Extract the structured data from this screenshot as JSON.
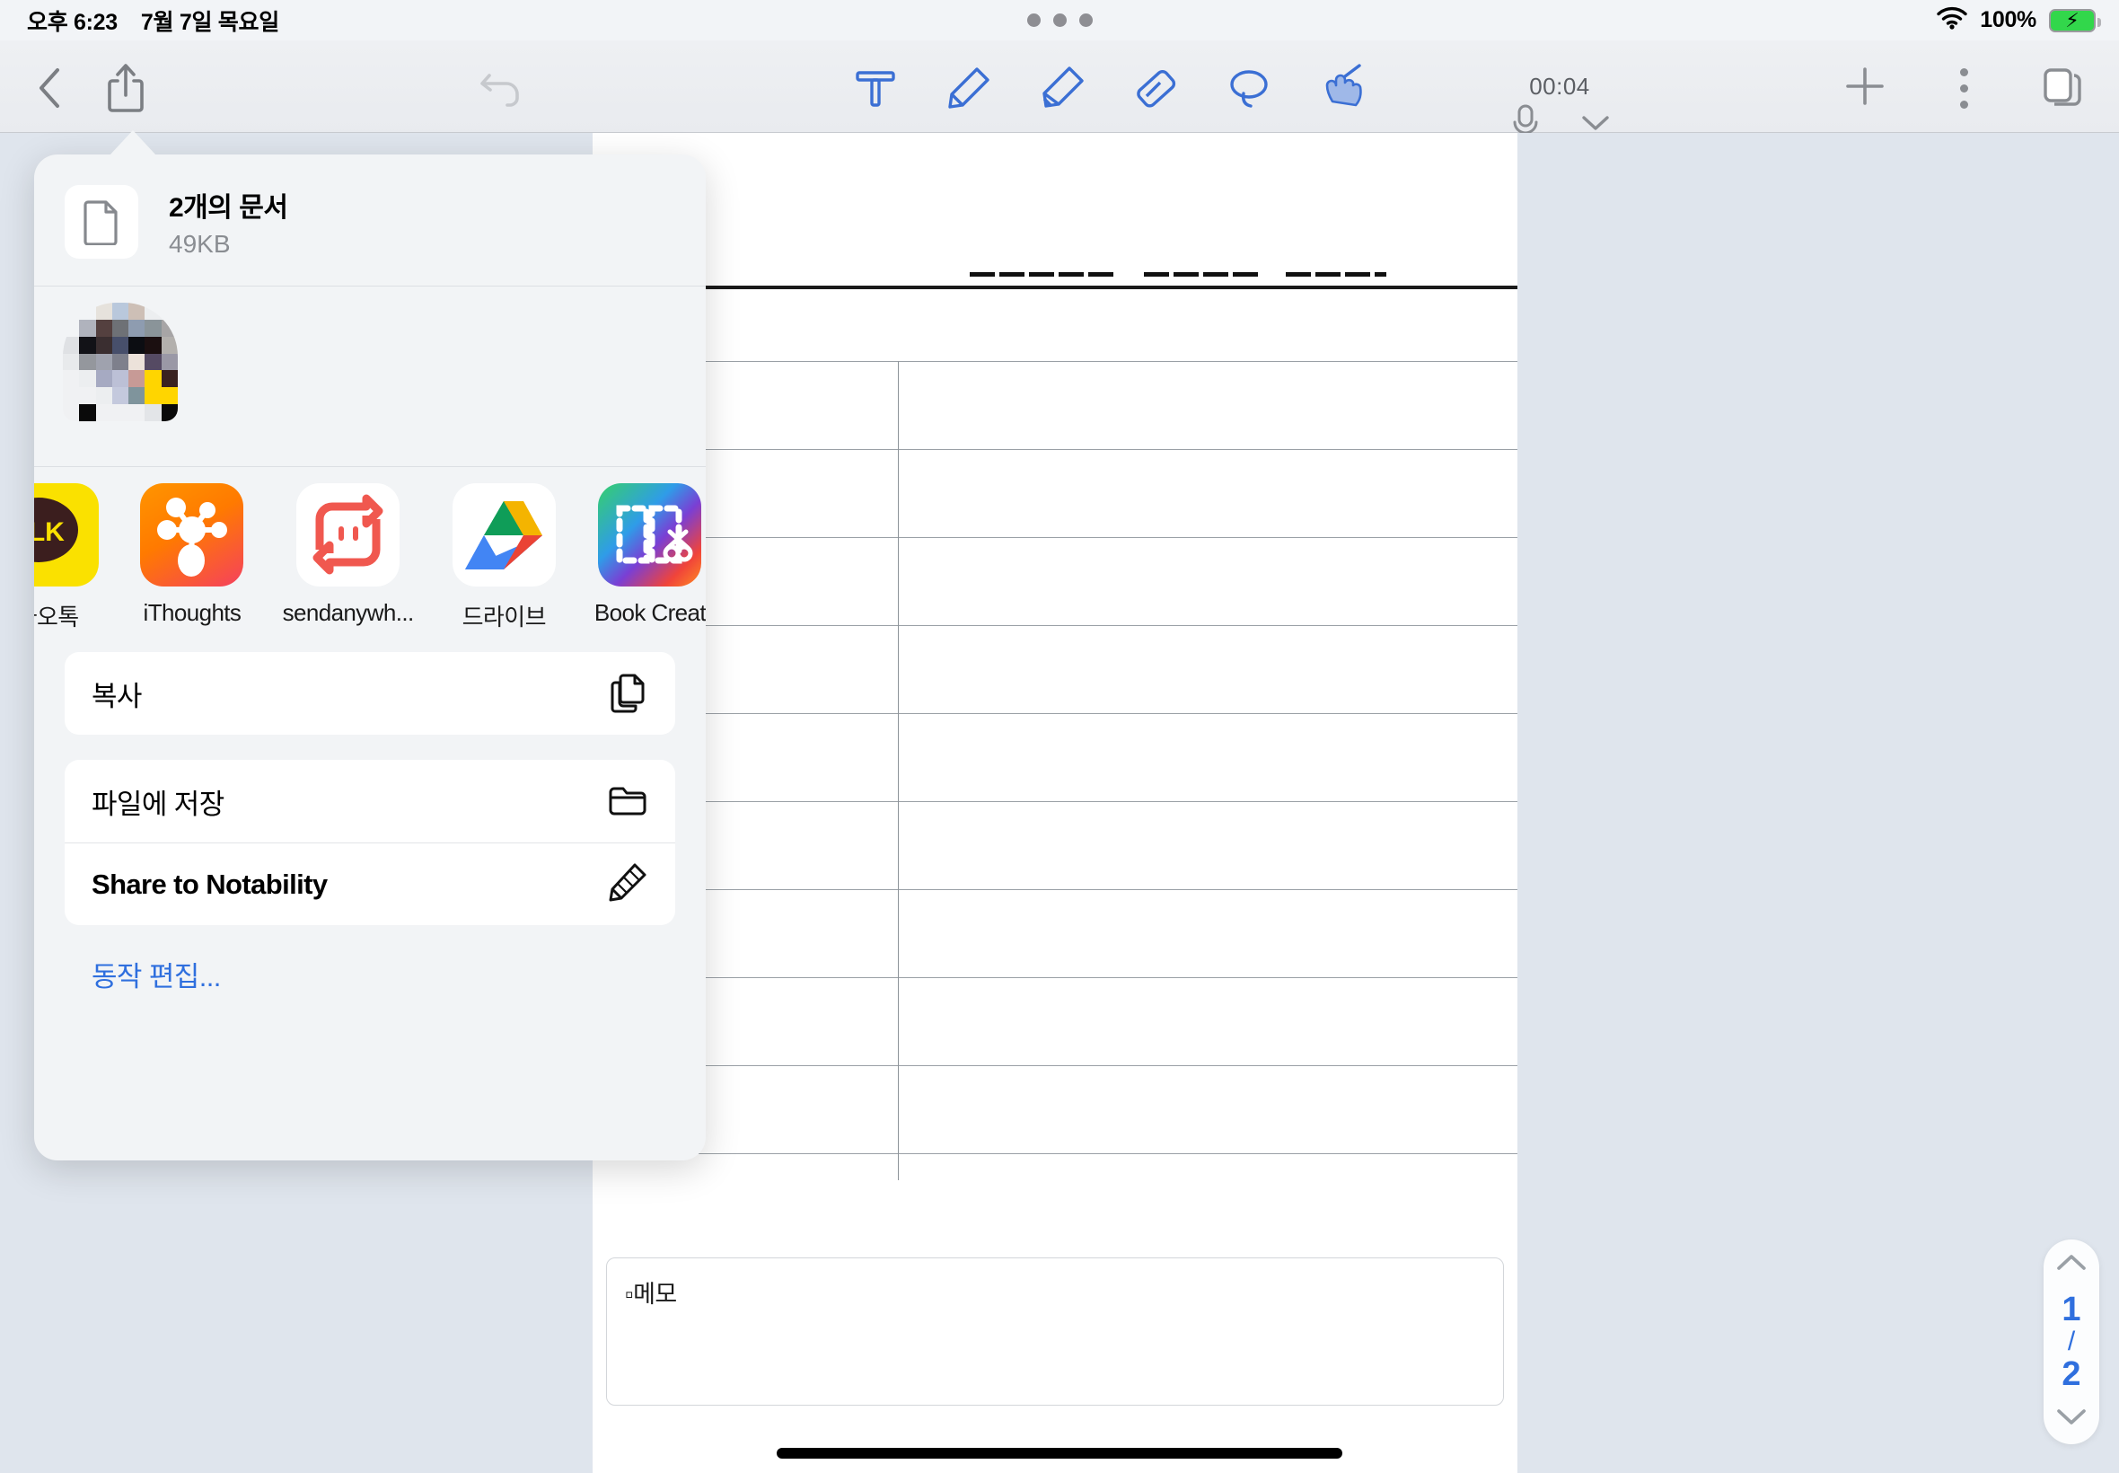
{
  "status_bar": {
    "time": "오후 6:23",
    "date": "7월 7일 목요일",
    "battery_percent": "100%",
    "wifi_icon": "wifi-icon",
    "battery_icon": "battery-charging-icon",
    "multitask_icon": "multitask-dots-icon"
  },
  "toolbar": {
    "back_icon": "chevron-left-icon",
    "share_icon": "share-up-arrow-icon",
    "undo_icon": "undo-arrow-icon",
    "tools": [
      {
        "name": "text-tool",
        "icon": "text-t-icon",
        "active": false
      },
      {
        "name": "pen-tool",
        "icon": "pen-icon",
        "active": false
      },
      {
        "name": "highlighter-tool",
        "icon": "highlighter-icon",
        "active": false
      },
      {
        "name": "eraser-tool",
        "icon": "eraser-icon",
        "active": false
      },
      {
        "name": "lasso-tool",
        "icon": "lasso-icon",
        "active": false
      },
      {
        "name": "hand-tool",
        "icon": "hand-pointer-icon",
        "active": true
      }
    ],
    "recording_time": "00:04",
    "mic_icon": "microphone-icon",
    "chevron_icon": "chevron-down-icon",
    "add_icon": "plus-icon",
    "more_icon": "kebab-menu-icon",
    "pages_icon": "pages-stack-icon"
  },
  "document": {
    "memo_label": "▫메모",
    "page_navigator": {
      "up_icon": "chevron-up-icon",
      "current_page": "1",
      "separator": "/",
      "total_pages": "2",
      "down_icon": "chevron-down-icon"
    }
  },
  "share_sheet": {
    "doc_icon": "document-icon",
    "title": "2개의 문서",
    "size": "49KB",
    "preview_name": "blurred-thumbnail-preview",
    "apps": [
      {
        "label": "카오톡",
        "icon": "kakaotalk-icon"
      },
      {
        "label": "iThoughts",
        "icon": "ithoughts-icon"
      },
      {
        "label": "sendanywh...",
        "icon": "sendanywhere-icon"
      },
      {
        "label": "드라이브",
        "icon": "google-drive-icon"
      },
      {
        "label": "Book Creat",
        "icon": "book-creator-icon"
      }
    ],
    "actions": [
      {
        "label": "복사",
        "icon": "copy-doc-on-doc-icon",
        "bold": false
      },
      {
        "label": "파일에 저장",
        "icon": "folder-icon",
        "bold": false
      },
      {
        "label": "Share to Notability",
        "icon": "pencil-icon",
        "bold": true
      }
    ],
    "edit_actions_label": "동작 편집...",
    "accent_color": "#2f6fde"
  }
}
